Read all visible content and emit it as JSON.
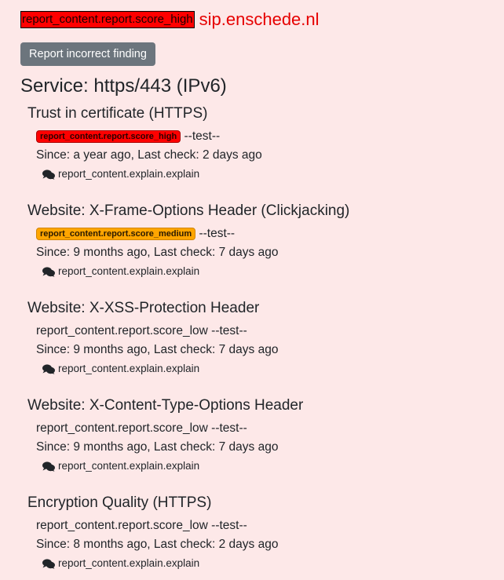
{
  "header": {
    "score_badge": "report_content.report.score_high",
    "site": "sip.enschede.nl"
  },
  "report_button": {
    "label": "Report incorrect finding"
  },
  "service": {
    "title": "Service: https/443 (IPv6)"
  },
  "findings": [
    {
      "title": "Trust in certificate (HTTPS)",
      "score": "report_content.report.score_high",
      "score_style": "badge-high",
      "test": "--test--",
      "since": "Since: a year ago, Last check: 2 days ago",
      "explain": "report_content.explain.explain"
    },
    {
      "title": "Website: X-Frame-Options Header (Clickjacking)",
      "score": "report_content.report.score_medium",
      "score_style": "badge-medium",
      "test": "--test--",
      "since": "Since: 9 months ago, Last check: 7 days ago",
      "explain": "report_content.explain.explain"
    },
    {
      "title": "Website: X-XSS-Protection Header",
      "score": "report_content.report.score_low",
      "score_style": "plain",
      "test": "--test--",
      "since": "Since: 9 months ago, Last check: 7 days ago",
      "explain": "report_content.explain.explain"
    },
    {
      "title": "Website: X-Content-Type-Options Header",
      "score": "report_content.report.score_low",
      "score_style": "plain",
      "test": "--test--",
      "since": "Since: 9 months ago, Last check: 7 days ago",
      "explain": "report_content.explain.explain"
    },
    {
      "title": "Encryption Quality (HTTPS)",
      "score": "report_content.report.score_low",
      "score_style": "plain",
      "test": "--test--",
      "since": "Since: 8 months ago, Last check: 2 days ago",
      "explain": "report_content.explain.explain"
    }
  ],
  "icons": {
    "explain": "comments-icon"
  },
  "colors": {
    "background": "#fde8e8",
    "high": "#ff0000",
    "medium": "#ffa500",
    "site_name": "#e60000",
    "button": "#6c757d"
  }
}
